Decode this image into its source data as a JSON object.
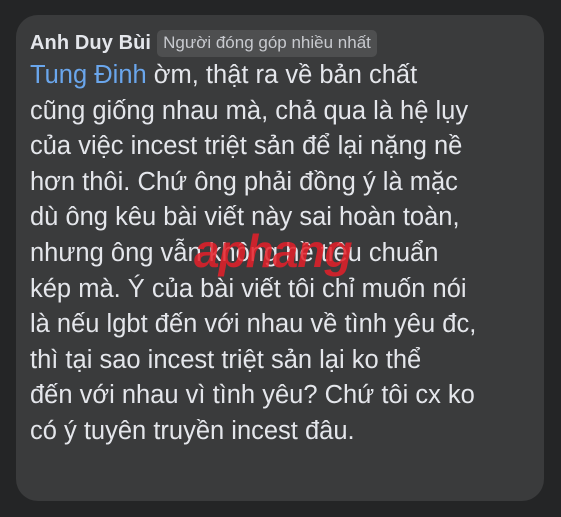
{
  "comment": {
    "author": "Anh Duy Bùi",
    "badge": "Người đóng góp nhiều nhất",
    "mention": "Tung Đinh",
    "lines": [
      " ờm, thật ra về bản chất",
      "cũng giống nhau mà, chả qua là hệ lụy",
      "của việc incest triệt sản để lại nặng nề",
      "hơn thôi. Chứ ông phải đồng ý là mặc",
      "dù ông kêu bài viết này sai hoàn toàn,",
      "nhưng ông vẫn không hề tiêu chuẩn",
      "kép mà. Ý của bài viết tôi chỉ muốn nói",
      "là nếu lgbt đến với nhau về tình yêu đc,",
      "thì tại sao incest triệt sản lại ko thể",
      "đến với nhau vì tình yêu? Chứ tôi cx ko",
      "có ý tuyên truyền incest đâu."
    ]
  },
  "watermark": "aphang",
  "colors": {
    "background": "#242526",
    "bubble": "#3a3b3c",
    "text": "#e4e6eb",
    "mention": "#6aa6ec",
    "badge_bg": "#4e4f50",
    "watermark": "#e52029"
  }
}
